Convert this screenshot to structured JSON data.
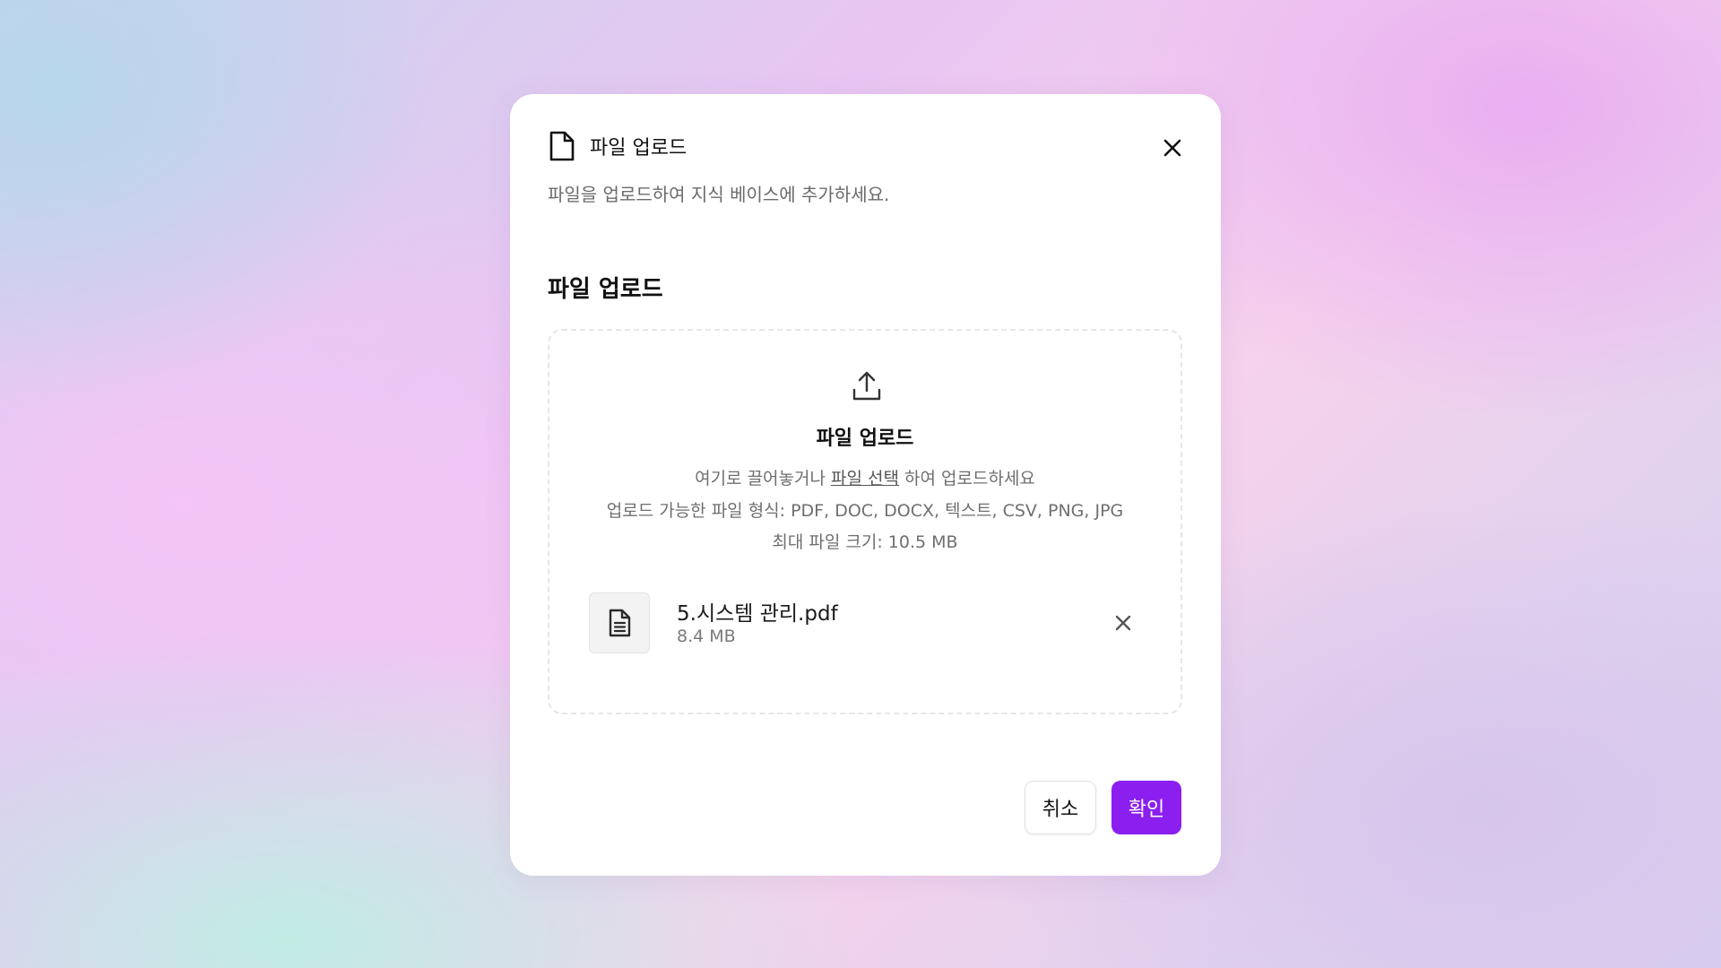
{
  "dialog": {
    "title": "파일 업로드",
    "subtitle": "파일을 업로드하여 지식 베이스에 추가하세요.",
    "section_title": "파일 업로드"
  },
  "dropzone": {
    "title": "파일 업로드",
    "line1_prefix": "여기로 끌어놓거나 ",
    "line1_link": "파일 선택",
    "line1_suffix": " 하여 업로드하세요",
    "formats": "업로드 가능한 파일 형식: PDF, DOC, DOCX, 텍스트, CSV, PNG, JPG",
    "max_size": "최대 파일 크기: 10.5 MB"
  },
  "file": {
    "name": "5.시스템 관리.pdf",
    "size": "8.4 MB"
  },
  "buttons": {
    "cancel": "취소",
    "confirm": "확인"
  },
  "colors": {
    "accent": "#8b1ff0"
  },
  "icons": {
    "header": "file-icon",
    "close": "close-icon",
    "upload": "upload-icon",
    "file": "file-text-icon",
    "remove": "close-icon"
  }
}
